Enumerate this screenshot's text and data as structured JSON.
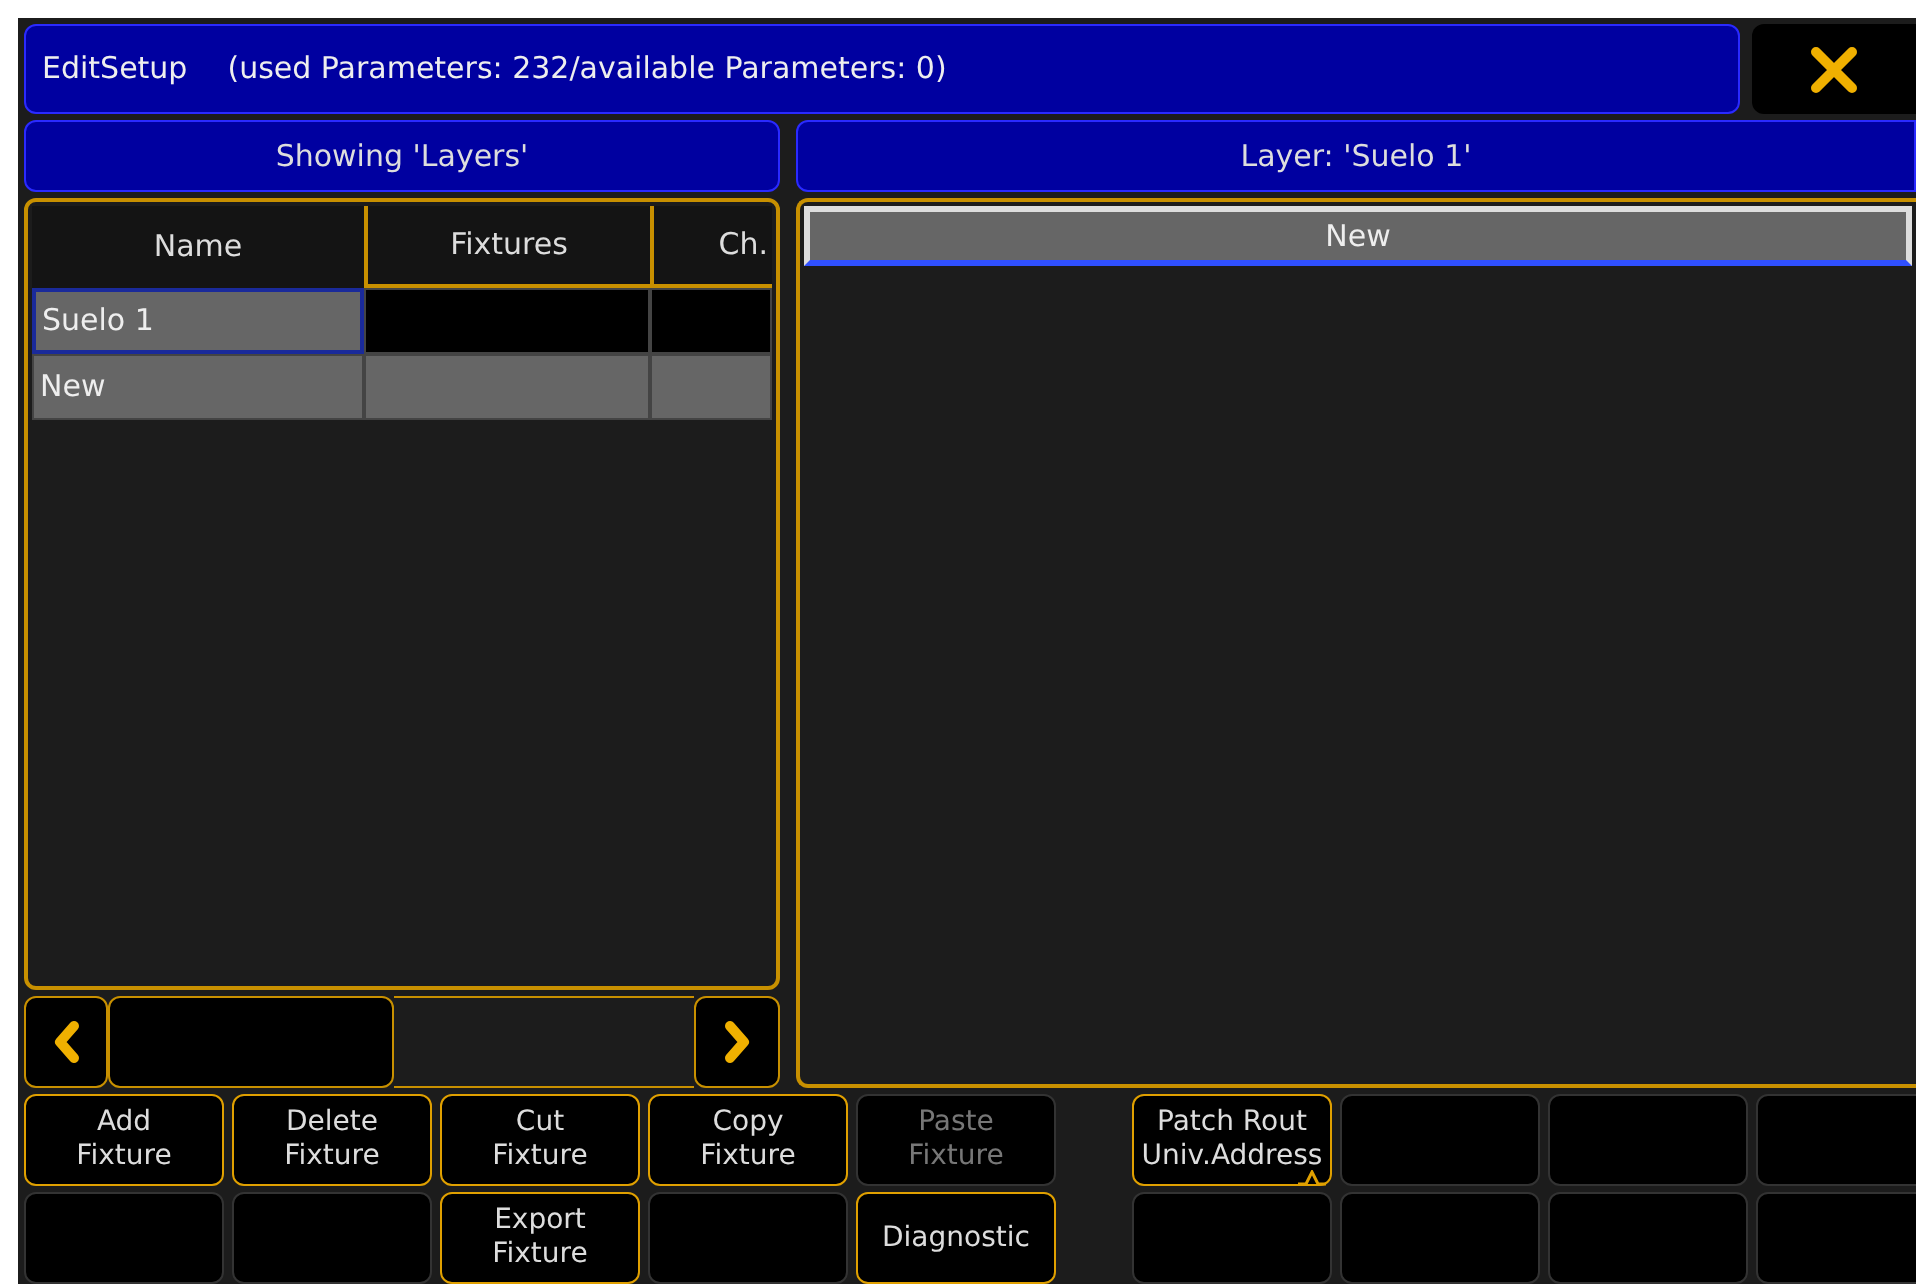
{
  "window": {
    "title": "EditSetup",
    "subtitle": "(used Parameters: 232/available Parameters: 0)"
  },
  "left_panel": {
    "header": "Showing 'Layers'",
    "table": {
      "columns": [
        "Name",
        "Fixtures",
        "Ch."
      ],
      "rows": [
        {
          "kind": "item",
          "selected": true,
          "cells": [
            "Suelo 1",
            "",
            ""
          ]
        },
        {
          "kind": "new",
          "selected": false,
          "cells": [
            "New",
            "",
            ""
          ]
        }
      ]
    }
  },
  "right_panel": {
    "header": "Layer: 'Suelo 1'",
    "new_button": "New"
  },
  "buttons": [
    [
      {
        "kind": "key",
        "label": "Add\nFixture",
        "disabled": false
      },
      {
        "kind": "key",
        "label": "Delete\nFixture",
        "disabled": false
      },
      {
        "kind": "key",
        "label": "Cut\nFixture",
        "disabled": false
      },
      {
        "kind": "key",
        "label": "Copy\nFixture",
        "disabled": false
      },
      {
        "kind": "key",
        "label": "Paste\nFixture",
        "disabled": true
      },
      {
        "kind": "gap"
      },
      {
        "kind": "menu",
        "label": "Patch Rout\nUniv.Address",
        "disabled": false
      },
      {
        "kind": "empty"
      },
      {
        "kind": "empty"
      },
      {
        "kind": "empty"
      }
    ],
    [
      {
        "kind": "empty"
      },
      {
        "kind": "empty"
      },
      {
        "kind": "key",
        "label": "Export\nFixture",
        "disabled": false
      },
      {
        "kind": "empty"
      },
      {
        "kind": "key",
        "label": "Diagnostic",
        "disabled": false
      },
      {
        "kind": "gap"
      },
      {
        "kind": "empty"
      },
      {
        "kind": "empty"
      },
      {
        "kind": "empty"
      },
      {
        "kind": "empty"
      }
    ]
  ]
}
